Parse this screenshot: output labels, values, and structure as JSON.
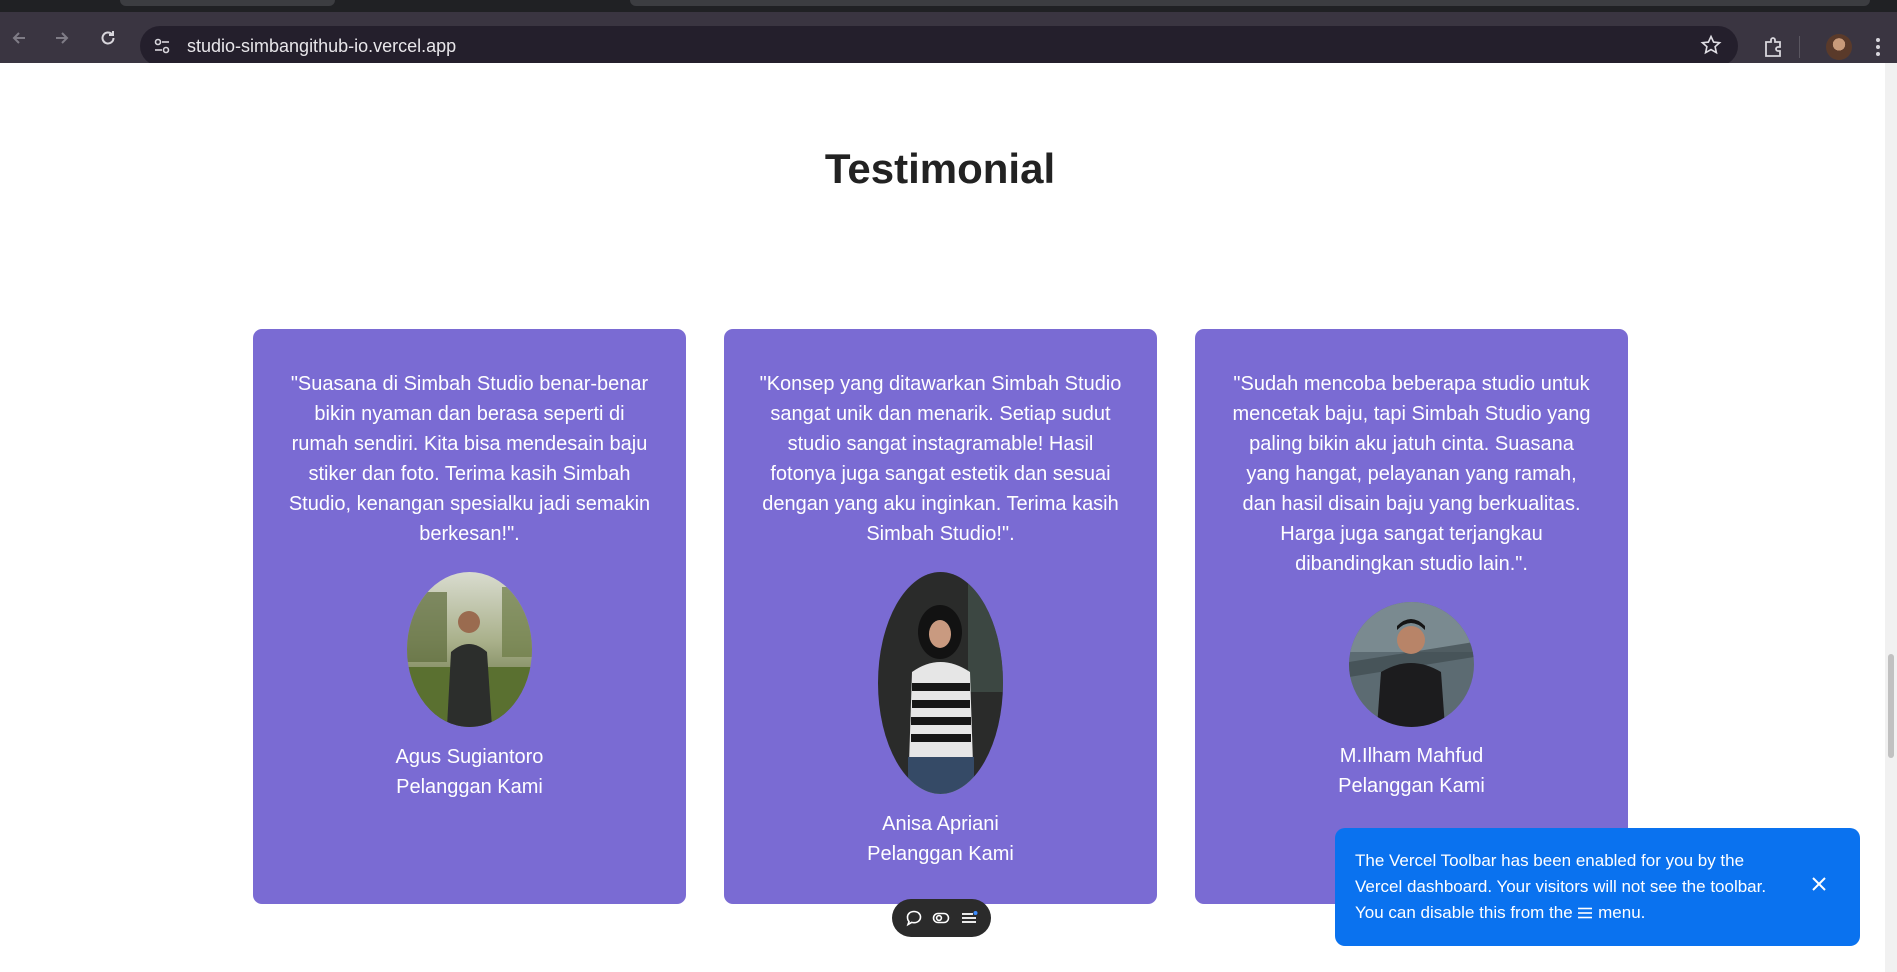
{
  "browser": {
    "url": "studio-simbangithub-io.vercel.app",
    "icons": [
      "back-icon",
      "forward-icon",
      "reload-icon",
      "site-info-icon",
      "bookmark-star-icon",
      "extensions-icon",
      "profile-avatar",
      "more-menu-icon"
    ]
  },
  "section": {
    "title": "Testimonial"
  },
  "testimonials": [
    {
      "quote": "\"Suasana di Simbah Studio benar-benar bikin nyaman dan berasa seperti di rumah sendiri. Kita bisa mendesain baju stiker dan foto. Terima kasih Simbah Studio, kenangan spesialku jadi semakin berkesan!\".",
      "name": "Agus Sugiantoro",
      "role": "Pelanggan Kami"
    },
    {
      "quote": "\"Konsep yang ditawarkan Simbah Studio sangat unik dan menarik. Setiap sudut studio sangat instagramable! Hasil fotonya juga sangat estetik dan sesuai dengan yang aku inginkan. Terima kasih Simbah Studio!\".",
      "name": "Anisa Apriani",
      "role": "Pelanggan Kami"
    },
    {
      "quote": "\"Sudah mencoba beberapa studio untuk mencetak baju, tapi Simbah Studio yang paling bikin aku jatuh cinta. Suasana yang hangat, pelayanan yang ramah, dan hasil disain baju yang berkualitas. Harga juga sangat terjangkau dibandingkan studio lain.\".",
      "name": "M.Ilham Mahfud",
      "role": "Pelanggan Kami"
    }
  ],
  "vercel_toast": {
    "message_before": "The Vercel Toolbar has been enabled for you by the Vercel dashboard. Your visitors will not see the toolbar. You can disable this from the ",
    "message_after": " menu."
  },
  "colors": {
    "card": "#7a6bd3",
    "toast": "#0a72ef",
    "chrome": "#3a3541"
  }
}
